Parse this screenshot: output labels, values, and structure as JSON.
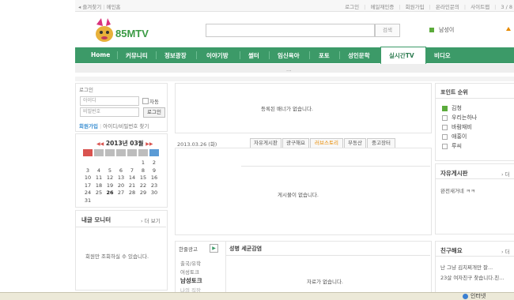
{
  "topbar": {
    "left_links": [
      "◂ 즐겨찾기",
      "메인홈"
    ],
    "right_links": [
      "로그인",
      "메일재인증",
      "회원가입",
      "온라인문의",
      "사이트맵",
      "3 / 8"
    ]
  },
  "header": {
    "logo_text": "85MTV",
    "search_placeholder": "",
    "search_button": "검색",
    "realtime_item": "남성이"
  },
  "nav": {
    "items": [
      "Home",
      "커뮤니티",
      "정보광장",
      "이야기방",
      "썰터",
      "임신육아",
      "포토",
      "성인문학",
      "실시간TV",
      "비디오"
    ],
    "active_index": 8
  },
  "subnav": {
    "dots": "..."
  },
  "login": {
    "title": "로그인",
    "id_placeholder": "아이디",
    "pw_placeholder": "비밀번호",
    "auto_label": "자동",
    "login_button": "로그인",
    "join_link": "회원가입",
    "find_link": "아이디/비밀번호 찾기"
  },
  "calendar": {
    "title": "2013년 03월",
    "weekday_colors": [
      "#d9534f",
      "#bdbdbd",
      "#bdbdbd",
      "#bdbdbd",
      "#bdbdbd",
      "#bdbdbd",
      "#5b9bd5"
    ],
    "weeks": [
      [
        "",
        "",
        "",
        "",
        "",
        "1",
        "2"
      ],
      [
        "3",
        "4",
        "5",
        "6",
        "7",
        "8",
        "9"
      ],
      [
        "10",
        "11",
        "12",
        "13",
        "14",
        "15",
        "16"
      ],
      [
        "17",
        "18",
        "19",
        "20",
        "21",
        "22",
        "23"
      ],
      [
        "24",
        "25",
        "26",
        "27",
        "28",
        "29",
        "30"
      ],
      [
        "31",
        "",
        "",
        "",
        "",
        "",
        ""
      ]
    ],
    "today": "26"
  },
  "monitor": {
    "title": "내글 모니터",
    "more": "› 더 보기",
    "message": "회원만 조회하실 수 있습니다."
  },
  "center": {
    "banner_text": "등록된 배너가 없습니다.",
    "date_text": "2013.03.26 (화)",
    "tabs": [
      "자유게시판",
      "광구해요",
      "러브스토리",
      "부동산",
      "중고장터"
    ],
    "board_empty": "게시물이 없습니다.",
    "bottom_left_title": "한줄광고",
    "bottom_left_items": [
      "출국/유학",
      "여성토크",
      "남성토크",
      "나의 직장"
    ],
    "bottom_right_title": "성병 세균감염",
    "bottom_right_empty": "자료가 없습니다."
  },
  "right": {
    "point_title": "포인트 순위",
    "point_items": [
      "김청",
      "우리는하나",
      "바람재비",
      "애홍이",
      "루씨"
    ],
    "free_title": "자유게시판",
    "free_more": "› 더",
    "free_items": [
      "완전새거네 ㅋㅋ"
    ],
    "friend_title": "친구해요",
    "friend_more": "› 더",
    "friend_items": [
      "난 그냥 김치찌개만 잘...",
      "23살 여자친구 찾습니다.친..."
    ]
  },
  "statusbar": {
    "zone": "인터넷"
  }
}
